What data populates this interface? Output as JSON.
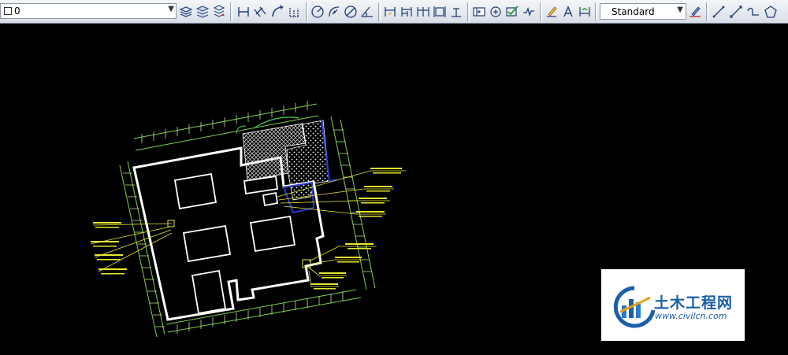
{
  "toolbar": {
    "layer_value": "0",
    "text_style_value": "Standard",
    "icons": [
      "layer-properties-icon",
      "layer-state-icon",
      "layer-previous-icon",
      "linear-dimension-icon",
      "aligned-dimension-icon",
      "arc-length-icon",
      "ordinate-dimension-icon",
      "radius-dimension-icon",
      "jogged-icon",
      "diameter-dimension-icon",
      "angular-dimension-icon",
      "quick-dimension-icon",
      "baseline-dimension-icon",
      "continue-dimension-icon",
      "dimension-space-icon",
      "dimension-break-icon",
      "tolerance-icon",
      "center-mark-icon",
      "inspection-icon",
      "jogged-linear-icon",
      "dimension-edit-icon",
      "dimension-text-edit-icon",
      "dimension-update-icon",
      "text-style-icon",
      "line-icon",
      "construction-line-icon",
      "polyline-icon",
      "polygon-icon"
    ]
  },
  "watermark": {
    "title": "土木工程网",
    "url": "www.civilcn.com"
  }
}
